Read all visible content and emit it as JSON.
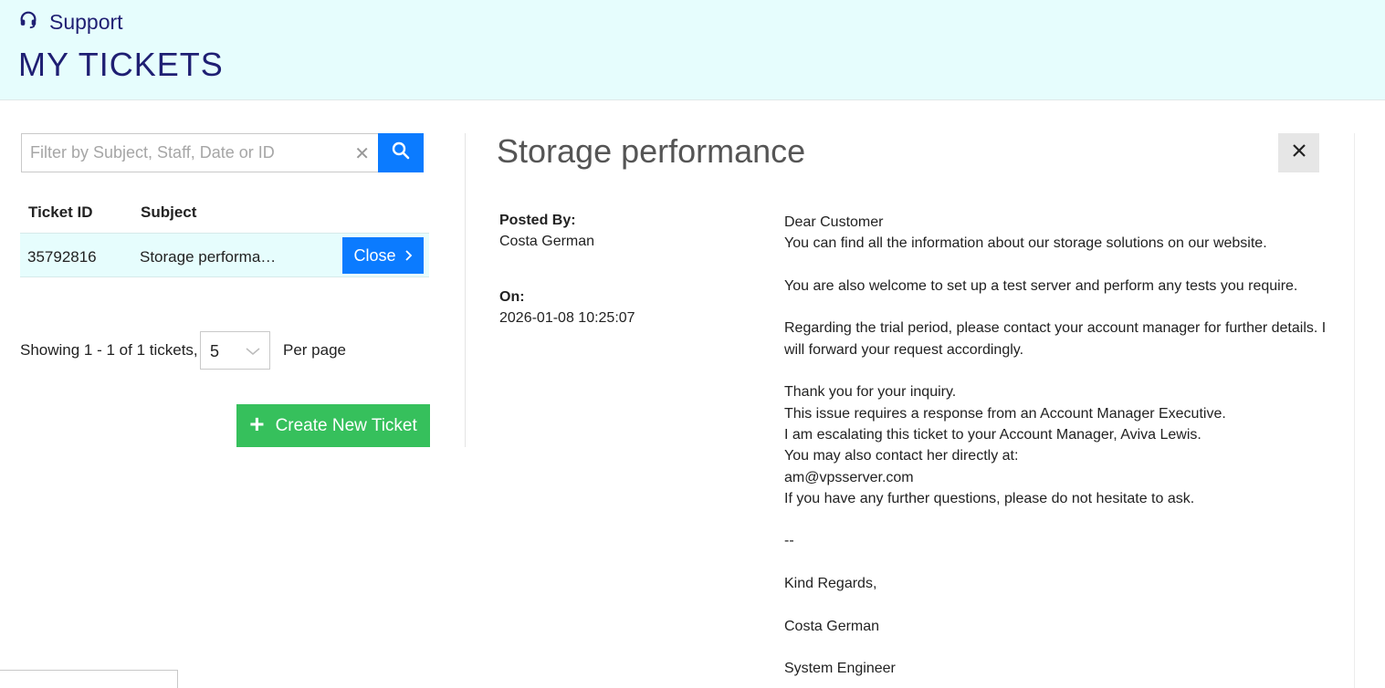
{
  "header": {
    "section": "Support",
    "section_icon": "headset-icon",
    "title": "MY TICKETS",
    "bg_color": "#e6fdfd",
    "text_color": "#1f1f73"
  },
  "search": {
    "placeholder": "Filter by Subject, Staff, Date or ID",
    "value": "",
    "clear_icon": "close-icon",
    "search_icon": "search-icon"
  },
  "table": {
    "columns": [
      "Ticket ID",
      "Subject"
    ],
    "rows": [
      {
        "id": "35792816",
        "subject": "Storage performance",
        "action": "Close"
      }
    ]
  },
  "pagination": {
    "showing": "Showing 1 - 1 of 1 tickets,",
    "per_page_value": "5",
    "per_page_label": "Per page"
  },
  "create_button": "Create New Ticket",
  "detail": {
    "title": "Storage performance",
    "posted_by_label": "Posted By:",
    "posted_by": "Costa German",
    "on_label": "On:",
    "on": "2026-01-08 10:25:07",
    "message": [
      "Dear Customer",
      "You can find all the information about our storage solutions on our website.",
      "",
      "You are also welcome to set up a test server and perform any tests you require.",
      "",
      "Regarding the trial period, please contact your account manager for further details. I will forward your request accordingly.",
      "",
      "Thank you for your inquiry.",
      "This issue requires a response from an Account Manager Executive.",
      "I am escalating this ticket to your Account Manager, Aviva Lewis.",
      "You may also contact her directly at:",
      "am@vpsserver.com",
      "If you have any further questions, please do not hesitate to ask.",
      "",
      "--",
      "",
      "Kind Regards,",
      "",
      "Costa German",
      "",
      "System Engineer"
    ]
  },
  "colors": {
    "primary": "#0b7bff",
    "success": "#36c05c",
    "row_highlight": "#e6fdfd"
  }
}
